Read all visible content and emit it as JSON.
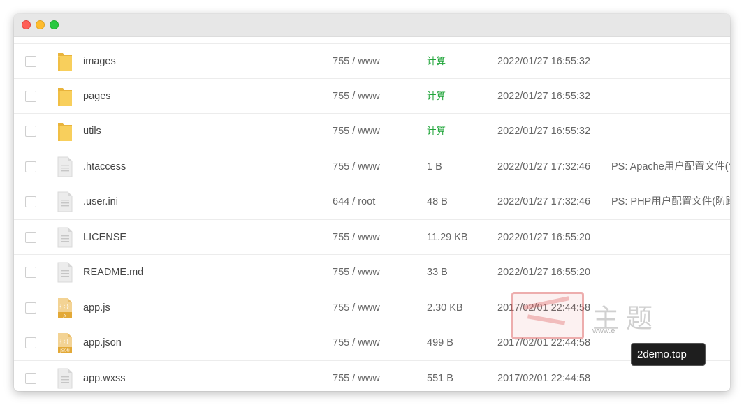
{
  "window": {
    "controls": [
      "close",
      "minimize",
      "maximize"
    ]
  },
  "files": [
    {
      "name": "images",
      "icon": "folder-icon",
      "permission": "755 / www",
      "size": "计算",
      "size_is_action": true,
      "modified": "2022/01/27 16:55:32",
      "note": ""
    },
    {
      "name": "pages",
      "icon": "folder-icon",
      "permission": "755 / www",
      "size": "计算",
      "size_is_action": true,
      "modified": "2022/01/27 16:55:32",
      "note": ""
    },
    {
      "name": "utils",
      "icon": "folder-icon",
      "permission": "755 / www",
      "size": "计算",
      "size_is_action": true,
      "modified": "2022/01/27 16:55:32",
      "note": ""
    },
    {
      "name": ".htaccess",
      "icon": "file-icon",
      "permission": "755 / www",
      "size": "1 B",
      "size_is_action": false,
      "modified": "2022/01/27 17:32:46",
      "note": "PS: Apache用户配置文件(伪"
    },
    {
      "name": ".user.ini",
      "icon": "file-icon",
      "permission": "644 / root",
      "size": "48 B",
      "size_is_action": false,
      "modified": "2022/01/27 17:32:46",
      "note": "PS: PHP用户配置文件(防跨站"
    },
    {
      "name": "LICENSE",
      "icon": "file-icon",
      "permission": "755 / www",
      "size": "11.29 KB",
      "size_is_action": false,
      "modified": "2022/01/27 16:55:20",
      "note": ""
    },
    {
      "name": "README.md",
      "icon": "file-icon",
      "permission": "755 / www",
      "size": "33 B",
      "size_is_action": false,
      "modified": "2022/01/27 16:55:20",
      "note": ""
    },
    {
      "name": "app.js",
      "icon": "js-file-icon",
      "permission": "755 / www",
      "size": "2.30 KB",
      "size_is_action": false,
      "modified": "2017/02/01 22:44:58",
      "note": ""
    },
    {
      "name": "app.json",
      "icon": "json-file-icon",
      "permission": "755 / www",
      "size": "499 B",
      "size_is_action": false,
      "modified": "2017/02/01 22:44:58",
      "note": ""
    },
    {
      "name": "app.wxss",
      "icon": "file-icon",
      "permission": "755 / www",
      "size": "551 B",
      "size_is_action": false,
      "modified": "2017/02/01 22:44:58",
      "note": ""
    }
  ],
  "watermark": {
    "title": "主题",
    "url": "www.e",
    "badge": "2demo.top"
  },
  "colors": {
    "calc_link": "#20a53a",
    "folder": "#f6c74f",
    "js_badge": "#e3a937",
    "traffic_close": "#fe5f57",
    "traffic_min": "#febc2e",
    "traffic_max": "#28c840"
  }
}
